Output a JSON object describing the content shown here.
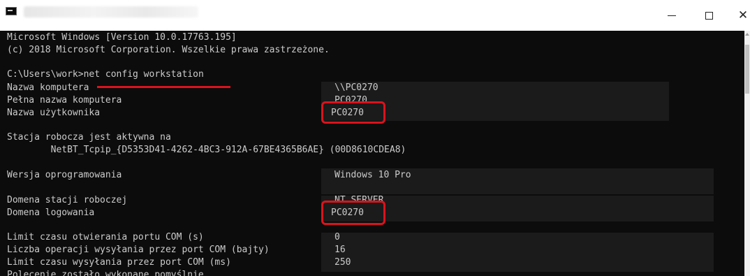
{
  "window": {
    "icon": "cmd-icon",
    "controls": {
      "minimize": "–",
      "maximize": "☐",
      "close": "✕"
    }
  },
  "console": {
    "header": [
      "Microsoft Windows [Version 10.0.17763.195]",
      "(c) 2018 Microsoft Corporation. Wszelkie prawa zastrzeżone."
    ],
    "prompt": "C:\\Users\\work>",
    "command": "net config workstation",
    "rows": {
      "computer_name": {
        "label": "Nazwa komputera",
        "value": "\\\\PC0270"
      },
      "full_computer_name": {
        "label": "Pełna nazwa komputera",
        "value": "PC0270"
      },
      "user_name": {
        "label": "Nazwa użytkownika",
        "value": "PC0270"
      },
      "active_on": {
        "label": "Stacja robocza jest aktywna na"
      },
      "netbt": {
        "text": "        NetBT_Tcpip_{D5353D41-4262-4BC3-912A-67BE4365B6AE} (00D8610CDEA8)"
      },
      "software_version": {
        "label": "Wersja oprogramowania",
        "value": "Windows 10 Pro"
      },
      "workstation_domain": {
        "label": "Domena stacji roboczej",
        "value": "NT SERVER"
      },
      "logon_domain": {
        "label": "Domena logowania",
        "value": "PC0270"
      },
      "com_open_timeout": {
        "label": "Limit czasu otwierania portu COM (s)",
        "value": "0"
      },
      "com_send_count": {
        "label": "Liczba operacji wysyłania przez port COM (bajty)",
        "value": "16"
      },
      "com_send_timeout": {
        "label": "Limit czasu wysyłania przez port COM (ms)",
        "value": "250"
      },
      "completion": {
        "label": "Polecenie zostało wykonane pomyślnie."
      }
    }
  },
  "colors": {
    "console_bg": "#0c0c0c",
    "console_text": "#cccccc",
    "highlight": "#d9141d"
  }
}
